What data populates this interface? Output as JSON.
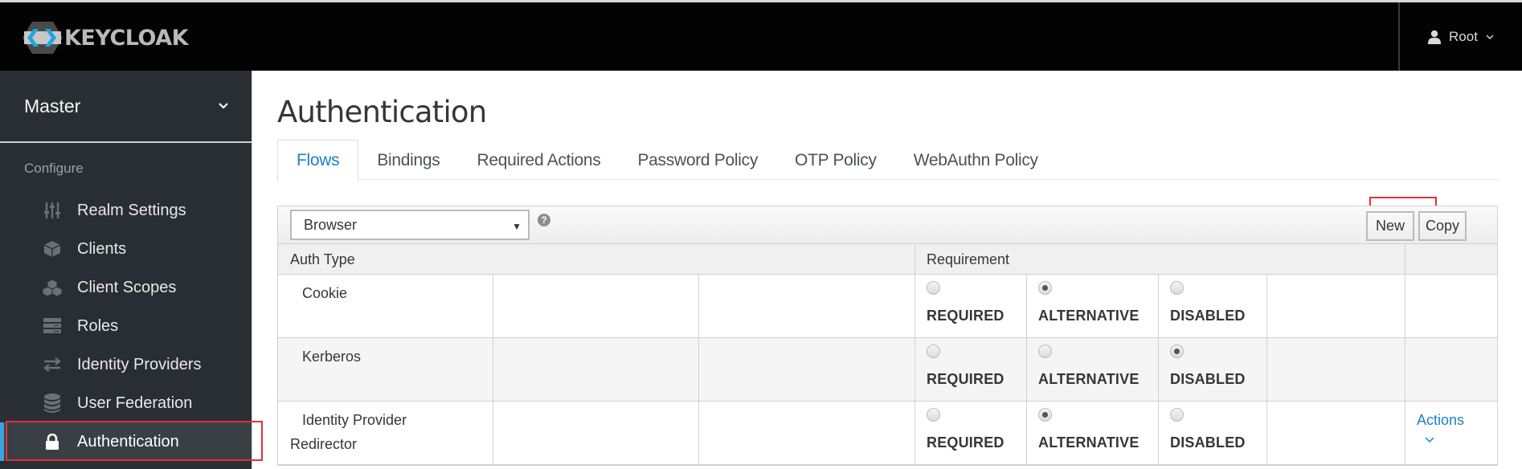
{
  "header": {
    "logo_text": "KEYCLOAK",
    "user": {
      "name": "Root",
      "icon": "user-icon",
      "dropdown_icon": "chevron-down-icon"
    }
  },
  "sidebar": {
    "realm": {
      "name": "Master",
      "icon": "chevron-down-icon"
    },
    "section_label": "Configure",
    "items": [
      {
        "label": "Realm Settings",
        "icon": "sliders-icon",
        "active": false
      },
      {
        "label": "Clients",
        "icon": "cube-icon",
        "active": false
      },
      {
        "label": "Client Scopes",
        "icon": "cubes-icon",
        "active": false
      },
      {
        "label": "Roles",
        "icon": "server-list-icon",
        "active": false
      },
      {
        "label": "Identity Providers",
        "icon": "exchange-icon",
        "active": false
      },
      {
        "label": "User Federation",
        "icon": "database-icon",
        "active": false
      },
      {
        "label": "Authentication",
        "icon": "lock-icon",
        "active": true
      }
    ],
    "active_color": "#39a5dc"
  },
  "main": {
    "title": "Authentication",
    "tabs": [
      {
        "label": "Flows",
        "active": true
      },
      {
        "label": "Bindings",
        "active": false
      },
      {
        "label": "Required Actions",
        "active": false
      },
      {
        "label": "Password Policy",
        "active": false
      },
      {
        "label": "OTP Policy",
        "active": false
      },
      {
        "label": "WebAuthn Policy",
        "active": false
      }
    ],
    "flow_select": {
      "value": "Browser",
      "arrow": "▼",
      "help_icon": "question-circle-icon"
    },
    "buttons": {
      "new": "New",
      "copy": "Copy"
    },
    "table": {
      "headers": {
        "auth_type": "Auth Type",
        "requirement": "Requirement"
      },
      "requirement_options": [
        "REQUIRED",
        "ALTERNATIVE",
        "DISABLED"
      ],
      "rows": [
        {
          "name_line1": "Cookie",
          "name_line2": "",
          "selected": "ALTERNATIVE",
          "actions": ""
        },
        {
          "name_line1": "Kerberos",
          "name_line2": "",
          "selected": "DISABLED",
          "actions": ""
        },
        {
          "name_line1": "Identity Provider",
          "name_line2": "Redirector",
          "selected": "ALTERNATIVE",
          "actions": "Actions"
        }
      ]
    }
  },
  "colors": {
    "accent": "#1a82c9",
    "highlight": "#e3303a",
    "header_bg": "#030303",
    "sidebar_bg": "#292e34"
  }
}
